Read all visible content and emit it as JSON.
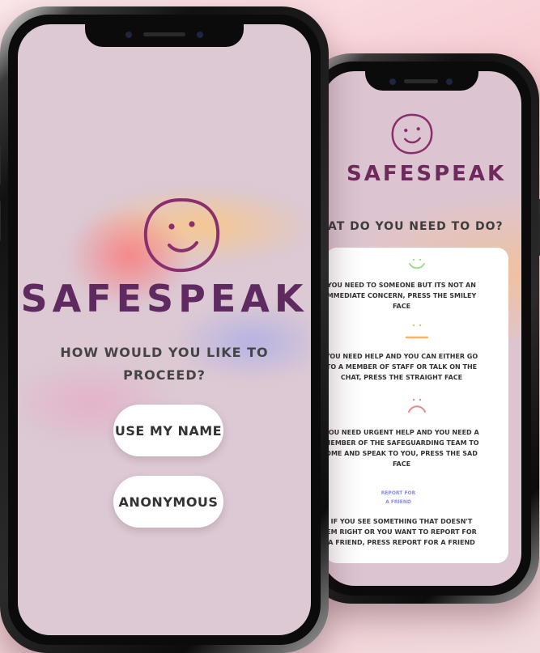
{
  "app": {
    "brand": "SAFESPEAK"
  },
  "front_screen": {
    "question": "HOW WOULD YOU LIKE TO PROCEED?",
    "buttons": {
      "use_name": "USE MY NAME",
      "anonymous": "ANONYMOUS"
    }
  },
  "back_screen": {
    "question": "...AT DO YOU NEED TO DO?",
    "options": [
      {
        "icon": "smiley-face-icon",
        "text_lines": [
          "YOU NEED TO SOMEONE BUT ITS NOT AN",
          "MMEDIATE CONCERN, PRESS THE SMILEY",
          "FACE"
        ]
      },
      {
        "icon": "straight-face-icon",
        "text_lines": [
          "YOU NEED HELP AND YOU CAN EITHER GO",
          "TO A MEMBER OF STAFF OR TALK ON THE",
          "CHAT, PRESS THE STRAIGHT FACE"
        ]
      },
      {
        "icon": "sad-face-icon",
        "text_lines": [
          "YOU NEED URGENT HELP AND YOU NEED A",
          "MEMBER OF THE SAFEGUARDING TEAM TO",
          "OME AND SPEAK TO YOU, PRESS THE SAD",
          "FACE"
        ]
      }
    ],
    "report_link": [
      "REPORT FOR",
      "A FRIEND"
    ],
    "report_text_lines": [
      "IF YOU SEE SOMETHING THAT DOESN'T",
      "EM RIGHT OR YOU WANT TO REPORT FOR",
      "A FRIEND, PRESS REPORT FOR A FRIEND"
    ]
  },
  "colors": {
    "brand": "#5e2a60",
    "smiley": "#9be08a",
    "straight": "#f0b766",
    "sad": "#e88a8a",
    "report_link": "#8a8ce6"
  }
}
